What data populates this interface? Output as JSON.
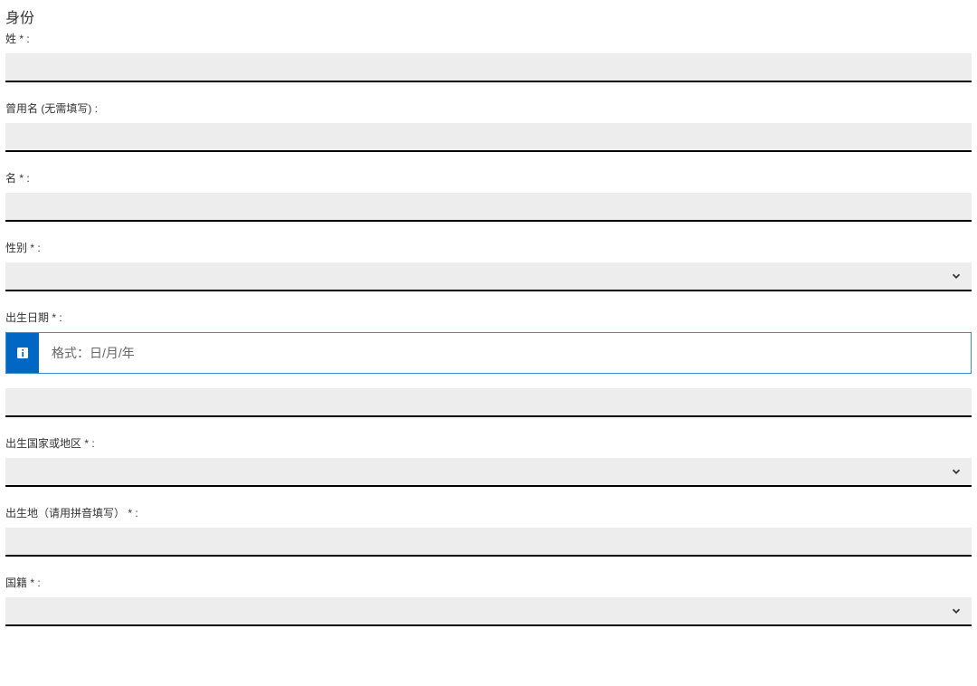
{
  "section_title": "身份",
  "fields": {
    "surname": {
      "label": "姓 * :"
    },
    "former_name": {
      "label": "曾用名 (无需填写) :"
    },
    "given_name": {
      "label": "名 * :"
    },
    "gender": {
      "label": "性别 * :"
    },
    "dob": {
      "label": "出生日期 * :",
      "hint": "格式：日/月/年"
    },
    "birth_country": {
      "label": "出生国家或地区 * :"
    },
    "birth_place": {
      "label": "出生地（请用拼音填写） * :"
    },
    "nationality": {
      "label": "国籍 * :"
    }
  }
}
